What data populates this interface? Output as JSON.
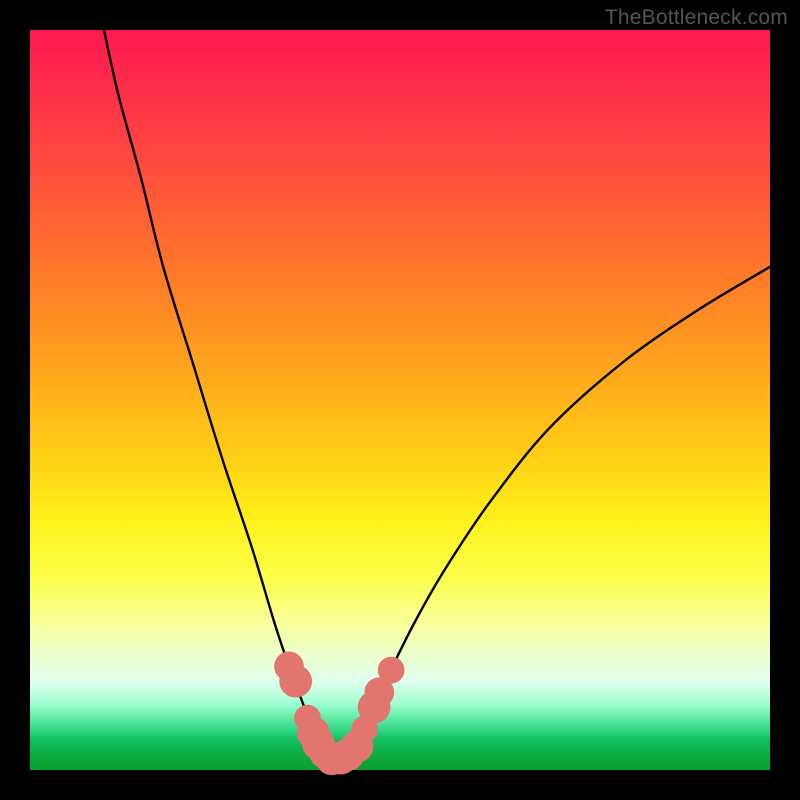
{
  "watermark": {
    "text": "TheBottleneck.com"
  },
  "colors": {
    "curve": "#000000",
    "marker_fill": "#e2766f",
    "marker_stroke": "#c9544d"
  },
  "chart_data": {
    "type": "line",
    "title": "",
    "xlabel": "",
    "ylabel": "",
    "xlim": [
      0,
      100
    ],
    "ylim": [
      0,
      100
    ],
    "series": [
      {
        "name": "curve",
        "x": [
          10,
          12,
          15,
          18,
          22,
          26,
          30,
          33,
          35,
          36.5,
          38,
          39,
          40,
          41,
          42,
          43,
          44.5,
          46,
          48,
          52,
          56,
          62,
          70,
          80,
          90,
          100
        ],
        "y": [
          100,
          91,
          80,
          68,
          55,
          42,
          30,
          20,
          14,
          10,
          6,
          3.5,
          2,
          1.5,
          2,
          3.2,
          5,
          8,
          12,
          20,
          27,
          36,
          46,
          55,
          62,
          68
        ]
      }
    ],
    "markers": [
      {
        "x": 35.0,
        "y": 14,
        "r": 1.2
      },
      {
        "x": 35.9,
        "y": 12,
        "r": 1.4
      },
      {
        "x": 37.5,
        "y": 7,
        "r": 1.0
      },
      {
        "x": 38.3,
        "y": 5,
        "r": 1.4
      },
      {
        "x": 39.0,
        "y": 3.5,
        "r": 1.4
      },
      {
        "x": 39.8,
        "y": 2.2,
        "r": 1.2
      },
      {
        "x": 40.8,
        "y": 1.5,
        "r": 1.4
      },
      {
        "x": 42.0,
        "y": 1.6,
        "r": 1.4
      },
      {
        "x": 43.0,
        "y": 2.1,
        "r": 1.4
      },
      {
        "x": 44.2,
        "y": 3.2,
        "r": 1.4
      },
      {
        "x": 45.2,
        "y": 5.5,
        "r": 1.0
      },
      {
        "x": 46.5,
        "y": 8.5,
        "r": 1.4
      },
      {
        "x": 47.2,
        "y": 10.5,
        "r": 1.2
      },
      {
        "x": 48.8,
        "y": 13.5,
        "r": 1.0
      }
    ]
  }
}
